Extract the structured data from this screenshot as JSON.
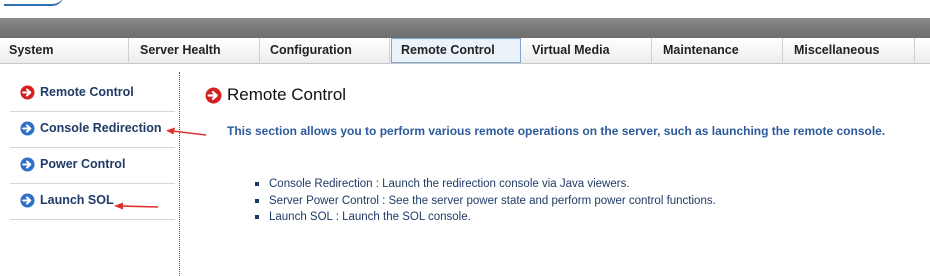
{
  "nav": {
    "tabs": [
      {
        "label": "System"
      },
      {
        "label": "Server Health"
      },
      {
        "label": "Configuration"
      },
      {
        "label": "Remote Control"
      },
      {
        "label": "Virtual Media"
      },
      {
        "label": "Maintenance"
      },
      {
        "label": "Miscellaneous"
      }
    ],
    "active_tab": "Remote Control"
  },
  "sidebar": {
    "items": [
      {
        "label": "Remote Control",
        "icon": "arrow-circle-icon",
        "icon_color": "#d42020"
      },
      {
        "label": "Console Redirection",
        "icon": "arrow-circle-icon",
        "icon_color": "#2f6fc8"
      },
      {
        "label": "Power Control",
        "icon": "arrow-circle-icon",
        "icon_color": "#2f6fc8"
      },
      {
        "label": "Launch SOL",
        "icon": "arrow-circle-icon",
        "icon_color": "#2f6fc8"
      }
    ]
  },
  "main": {
    "title": "Remote Control",
    "intro": "This section allows you to perform various remote operations on the server, such as launching the remote console.",
    "bullets": [
      "Console Redirection  : Launch the redirection console via Java viewers.",
      "Server Power Control  : See the server power state and perform power control functions.",
      "Launch SOL  : Launch the SOL console."
    ]
  },
  "colors": {
    "accent_red": "#d42020",
    "accent_blue": "#2f6fc8",
    "link_text": "#1f3a66",
    "intro_text": "#2d5a9c",
    "annotation_arrow": "#e03030"
  }
}
